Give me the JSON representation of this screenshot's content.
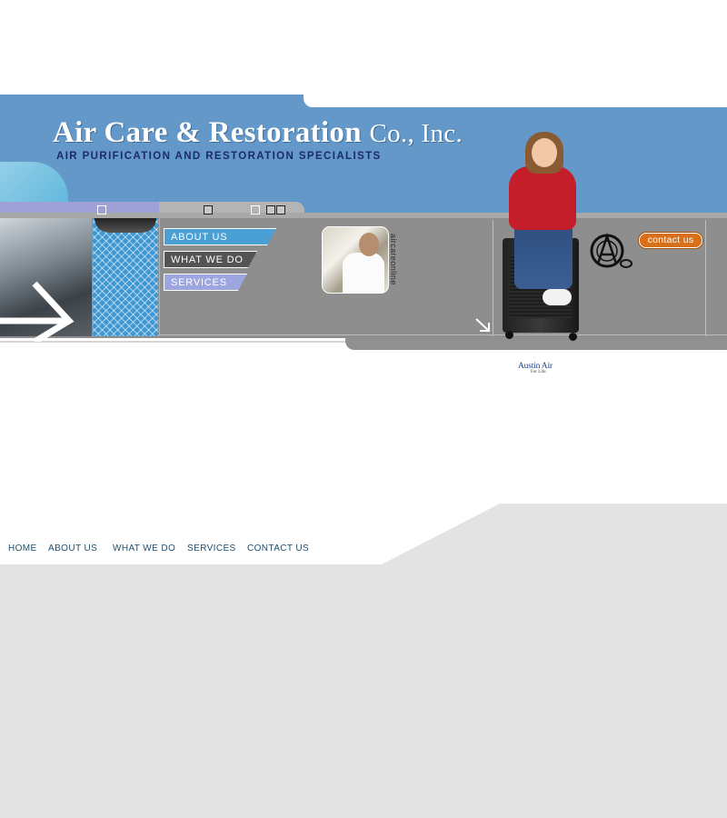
{
  "header": {
    "brand_main": "Air Care & Restoration",
    "brand_suffix": "Co., Inc.",
    "tagline": "AIR PURIFICATION AND RESTORATION SPECIALISTS"
  },
  "nav": {
    "about": "ABOUT US",
    "what": "WHAT WE DO",
    "services": "SERVICES"
  },
  "showcase": {
    "vertical_caption": "aircareonline",
    "contact_button": "contact us"
  },
  "austin_logo": {
    "name": "Austin Air",
    "sub": "For Life."
  },
  "footer_nav": {
    "home": "HOME",
    "about": "ABOUT US",
    "what": "WHAT WE DO",
    "services": "SERVICES",
    "contact": "CONTACT US"
  },
  "colors": {
    "header_blue": "#6398c8",
    "band_gray": "#8e8e8e",
    "tagline_navy": "#1c2b6a",
    "contact_orange": "#d8701a",
    "footer_gray": "#e3e3e3"
  }
}
